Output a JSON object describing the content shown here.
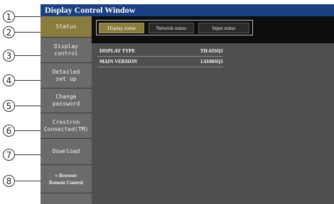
{
  "window": {
    "title": "Display Control Window"
  },
  "callouts": [
    "1",
    "2",
    "3",
    "4",
    "5",
    "6",
    "7",
    "8"
  ],
  "tabs": [
    {
      "label": "Display status",
      "active": true
    },
    {
      "label": "Network status",
      "active": false
    },
    {
      "label": "Input status",
      "active": false
    }
  ],
  "sidebar": {
    "items": [
      {
        "line1": "Status",
        "line2": "",
        "active": true
      },
      {
        "line1": "Display",
        "line2": "control",
        "active": false
      },
      {
        "line1": "Detailed",
        "line2": "set up",
        "active": false
      },
      {
        "line1": "Change",
        "line2": "password",
        "active": false
      },
      {
        "line1": "Crestron",
        "line2": "Connected(TM)",
        "active": false
      },
      {
        "line1": "Download",
        "line2": "",
        "active": false
      },
      {
        "line1": "» Browser",
        "line2": "Remote Control",
        "active": false
      }
    ]
  },
  "info": {
    "rows": [
      {
        "key": "DISPLAY TYPE",
        "value": "TH-65SQ1"
      },
      {
        "key": "MAIN VERSION",
        "value": "1.6100SQ1"
      }
    ]
  },
  "colors": {
    "titlebar": "#1a3f82",
    "active": "#8a7b3e",
    "sidebar": "#6b6b6b",
    "content": "#4f4f4f"
  }
}
